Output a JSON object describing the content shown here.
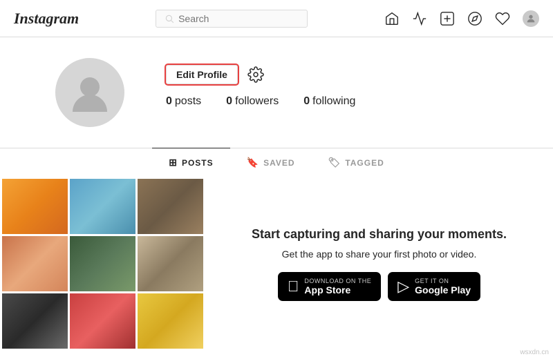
{
  "header": {
    "logo": "Instagram",
    "search_placeholder": "Search",
    "icons": {
      "home": "🏠",
      "filter": "▽",
      "add": "⊕",
      "explore": "⊙",
      "heart": "♡"
    }
  },
  "profile": {
    "edit_button": "Edit Profile",
    "stats": {
      "posts_count": "0",
      "posts_label": "posts",
      "followers_count": "0",
      "followers_label": "followers",
      "following_count": "0",
      "following_label": "following"
    }
  },
  "tabs": [
    {
      "id": "posts",
      "label": "POSTS",
      "active": true
    },
    {
      "id": "saved",
      "label": "SAVED",
      "active": false
    },
    {
      "id": "tagged",
      "label": "TAGGED",
      "active": false
    }
  ],
  "promo": {
    "title": "Start capturing and sharing your moments.",
    "subtitle": "Get the app to share your first photo or video.",
    "app_store": {
      "small": "Download on the",
      "large": "App Store"
    },
    "google_play": {
      "small": "GET IT ON",
      "large": "Google Play"
    }
  },
  "watermark": "wsxdn.cn"
}
